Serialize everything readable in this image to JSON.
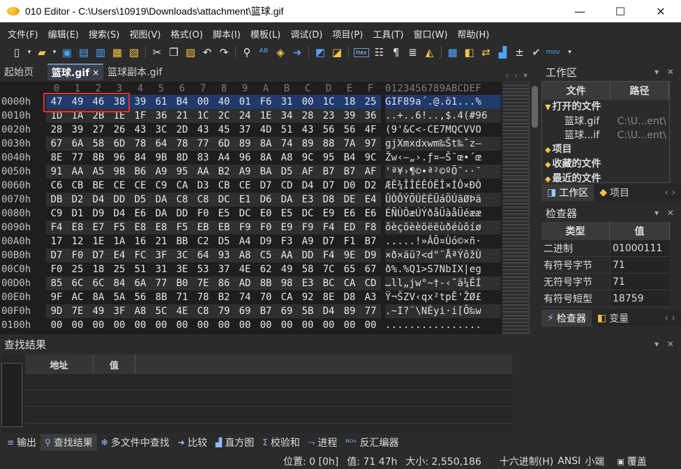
{
  "window": {
    "title": "010 Editor - C:\\Users\\10919\\Downloads\\attachment\\篮球.gif"
  },
  "menu": [
    "文件(F)",
    "编辑(E)",
    "搜索(S)",
    "视图(V)",
    "格式(O)",
    "脚本(I)",
    "模板(L)",
    "调试(D)",
    "项目(P)",
    "工具(T)",
    "窗口(W)",
    "帮助(H)"
  ],
  "tabs": {
    "start": "起始页",
    "active": "篮球.gif",
    "close": "×",
    "other": "篮球副本.gif"
  },
  "hex": {
    "header_cols": [
      "0",
      "1",
      "2",
      "3",
      "4",
      "5",
      "6",
      "7",
      "8",
      "9",
      "A",
      "B",
      "C",
      "D",
      "E",
      "F"
    ],
    "header_ascii": "0123456789ABCDEF",
    "rows": [
      {
        "addr": "0000h",
        "bytes": "47 49 46 38 39 61 B4 00 40 01 F6 31 00 1C 18 25",
        "ascii": "GIF89a´.@.ö1...%"
      },
      {
        "addr": "0010h",
        "bytes": "1D 1A 2B 1E 1F 36 21 1C 2C 24 1E 34 28 23 39 36",
        "ascii": "..+..6!..,$.4(#96"
      },
      {
        "addr": "0020h",
        "bytes": "28 39 27 26 43 3C 2D 43 45 37 4D 51 43 56 56 4F",
        "ascii": "(9'&C<-CE7MQCVVO"
      },
      {
        "addr": "0030h",
        "bytes": "67 6A 58 6D 78 64 78 77 6D 89 8A 74 89 88 7A 97",
        "ascii": "gjXmxdxwm‰Št‰ˆz—"
      },
      {
        "addr": "0040h",
        "bytes": "8E 77 8B 96 84 9B 8D 83 A4 96 8A A8 9C 95 B4 9C",
        "ascii": "Žw‹–„›.ƒ¤–Š¨œ•´œ"
      },
      {
        "addr": "0050h",
        "bytes": "91 AA A5 9B B6 A9 95 AA B2 A9 BA D5 AF B7 B7 AF",
        "ascii": "'ª¥›¶©•ª²©ºÕ¯··¯"
      },
      {
        "addr": "0060h",
        "bytes": "C6 CB BE CE CE C9 CA D3 CB CE D7 CD D4 D7 D0 D2",
        "ascii": "ÆË¾ÎÎÉÊÓËÎ×ÍÔ×ÐÒ"
      },
      {
        "addr": "0070h",
        "bytes": "DB D2 D4 DD D5 DA C8 C8 DC E1 D6 DA E3 D8 DE E4",
        "ascii": "ÛÒÔÝÕÚÈÈÜáÖÚãØÞä"
      },
      {
        "addr": "0080h",
        "bytes": "C9 D1 D9 D4 E6 DA DD F0 E5 DC E0 E5 DC E9 E6 E6",
        "ascii": "ÉÑÙÔæÚÝðåÜàåÜéææ"
      },
      {
        "addr": "0090h",
        "bytes": "F4 E8 E7 F5 E8 E8 F5 EB EB F9 F0 E9 F9 F4 ED F8",
        "ascii": "ôèçõèèõëëùðéùôíø"
      },
      {
        "addr": "00A0h",
        "bytes": "17 12 1E 1A 16 21 BB C2 D5 A4 D9 F3 A9 D7 F1 B7",
        "ascii": ".....!»ÂÕ¤Ùó©×ñ·"
      },
      {
        "addr": "00B0h",
        "bytes": "D7 F0 D7 E4 FC 3F 3C 64 93 A8 C5 AA DD F4 9E D9",
        "ascii": "×ð×äü?<d\"¨ÅªÝôžÙ"
      },
      {
        "addr": "00C0h",
        "bytes": "F0 25 18 25 51 31 3E 53 37 4E 62 49 58 7C 65 67",
        "ascii": "ð%.%Q1>S7NbIX|eg"
      },
      {
        "addr": "00D0h",
        "bytes": "85 6C 6C 84 6A 77 B0 7E 86 AD 8B 98 E3 BC CA CD",
        "ascii": "…ll„jw°~†-‹˜ã¼ÊÍ"
      },
      {
        "addr": "00E0h",
        "bytes": "9F AC 8A 5A 56 8B 71 78 B2 74 70 CA 92 8E D8 A3",
        "ascii": "Ÿ¬ŠZV‹qx²tpÊ'ŽØ£"
      },
      {
        "addr": "00F0h",
        "bytes": "9D 7E 49 3F A8 5C 4E C8 79 69 B7 69 5B D4 89 77",
        "ascii": ".~I?¨\\NÈyi·i[Ô‰w"
      },
      {
        "addr": "0100h",
        "bytes": "00 00 00 00 00 00 00 00 00 00 00 00 00 00 00 00",
        "ascii": "................"
      }
    ]
  },
  "workspace": {
    "title": "工作区",
    "col_file": "文件",
    "col_path": "路径",
    "open_files": "打开的文件",
    "files": [
      {
        "name": "篮球.gif",
        "path": "C:\\U...ent\\"
      },
      {
        "name": "篮球...if",
        "path": "C:\\U...ent\\"
      }
    ],
    "projects": "项目",
    "favorites": "收藏的文件",
    "recent": "最近的文件",
    "tab_workspace": "工作区",
    "tab_project": "项目"
  },
  "inspector": {
    "title": "检查器",
    "col_type": "类型",
    "col_value": "值",
    "rows": [
      {
        "k": "二进制",
        "v": "01000111"
      },
      {
        "k": "有符号字节",
        "v": "71"
      },
      {
        "k": "无符号字节",
        "v": "71"
      },
      {
        "k": "有符号短型",
        "v": "18759"
      }
    ],
    "tab_inspector": "检查器",
    "tab_vars": "变量"
  },
  "find": {
    "title": "查找结果",
    "col_addr": "地址",
    "col_value": "值"
  },
  "bottom_tabs": [
    "输出",
    "查找结果",
    "多文件中查找",
    "比较",
    "直方图",
    "校验和",
    "进程",
    "反汇编器"
  ],
  "status": {
    "position": "位置: 0 [0h]",
    "value": "值: 71 47h",
    "size": "大小: 2,550,186",
    "mode": "十六进制(H)",
    "encoding": "ANSI",
    "endian": "小端",
    "insert": "覆盖"
  },
  "colors": {
    "selection": "#203a6c",
    "highlight_box": "#e03030",
    "folder": "#f3c545"
  }
}
